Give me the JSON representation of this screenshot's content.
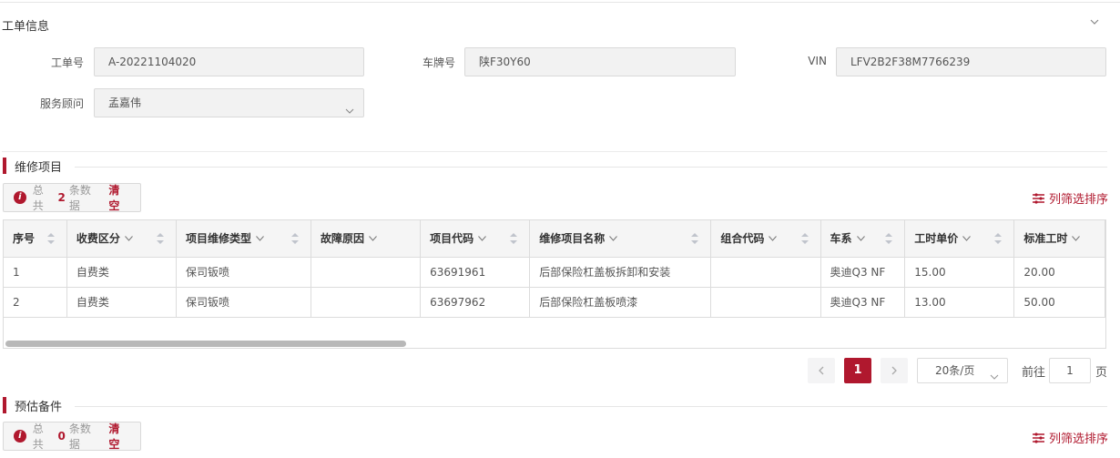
{
  "work_order_section": {
    "title": "工单信息",
    "order_no_label": "工单号",
    "order_no_value": "A-20221104020",
    "plate_label": "车牌号",
    "plate_value": "陕F30Y60",
    "vin_label": "VIN",
    "vin_value": "LFV2B2F38M7766239",
    "advisor_label": "服务顾问",
    "advisor_value": "孟嘉伟"
  },
  "repair_items": {
    "title": "维修项目",
    "summary_prefix": "总共",
    "count": "2",
    "summary_suffix": "条数据",
    "clear_label": "清空",
    "column_sort_label": "列筛选排序",
    "columns": [
      "序号",
      "收费区分",
      "项目维修类型",
      "故障原因",
      "项目代码",
      "维修项目名称",
      "组合代码",
      "车系",
      "工时单价",
      "标准工时"
    ],
    "rows": [
      [
        "1",
        "自费类",
        "保司钣喷",
        "",
        "63691961",
        "后部保险杠盖板拆卸和安装",
        "",
        "奥迪Q3 NF",
        "15.00",
        "20.00"
      ],
      [
        "2",
        "自费类",
        "保司钣喷",
        "",
        "63697962",
        "后部保险杠盖板喷漆",
        "",
        "奥迪Q3 NF",
        "13.00",
        "50.00"
      ]
    ]
  },
  "pagination": {
    "current_page": "1",
    "page_size": "20条/页",
    "goto_label": "前往",
    "goto_value": "1",
    "page_unit": "页"
  },
  "spare_parts": {
    "title": "预估备件",
    "summary_prefix": "总共",
    "count": "0",
    "summary_suffix": "条数据",
    "clear_label": "清空",
    "column_sort_label": "列筛选排序"
  },
  "colors": {
    "accent": "#b0182e",
    "header_bg": "#f5f5f5",
    "field_bg": "#f2f2f2"
  }
}
